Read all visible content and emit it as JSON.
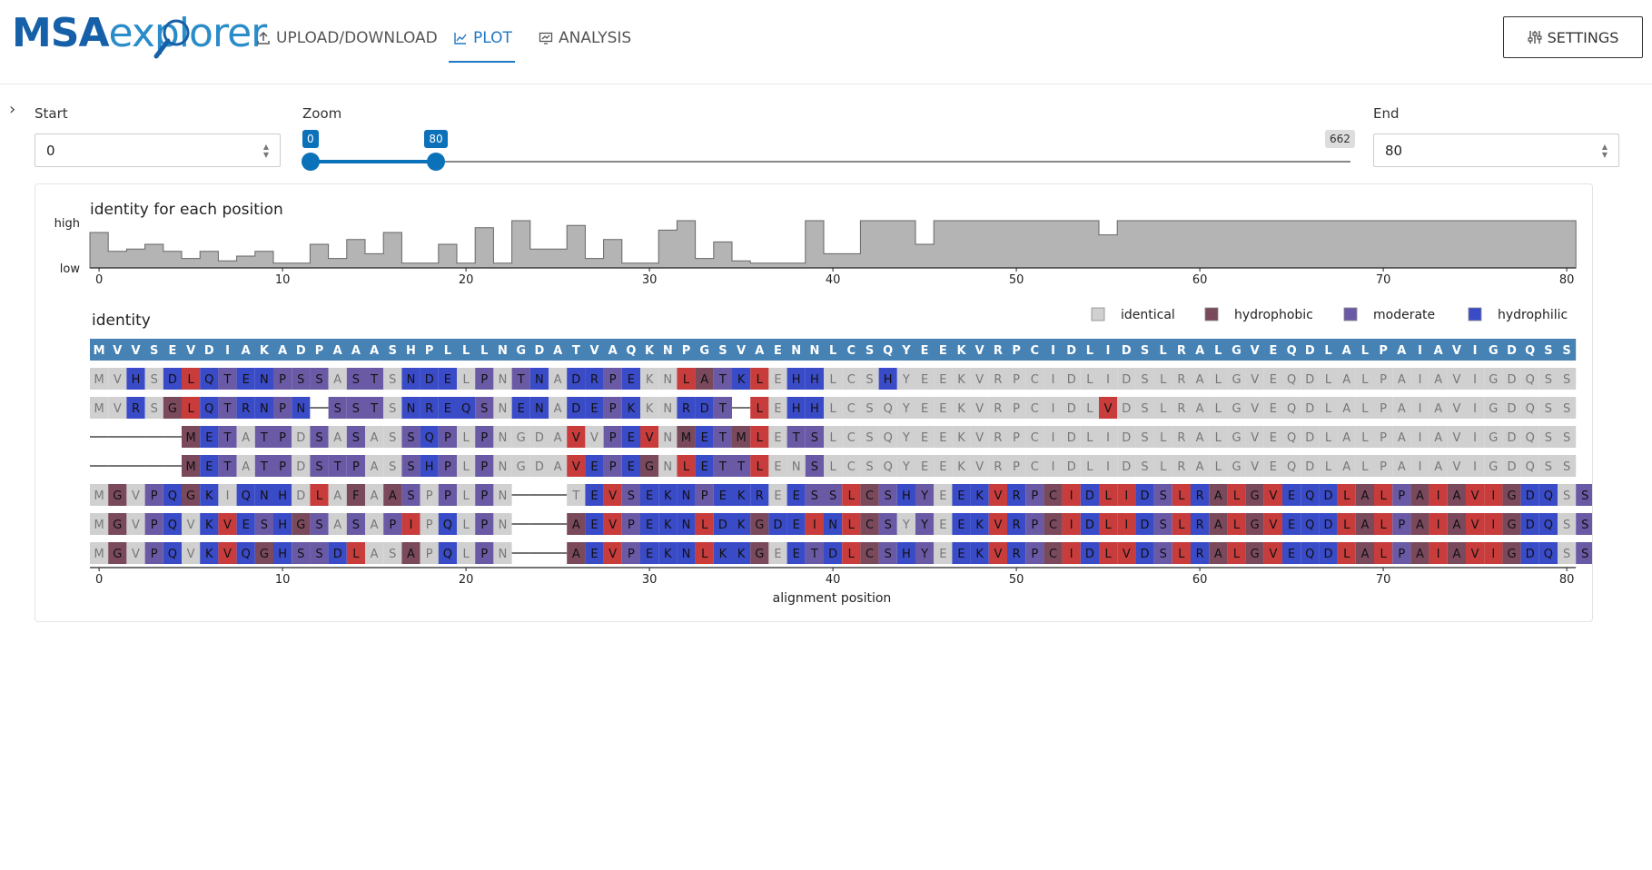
{
  "app": {
    "logo_main": "MSA",
    "logo_rest": "explorer"
  },
  "nav": [
    {
      "label": "UPLOAD/DOWNLOAD",
      "icon": "upload-icon",
      "active": false
    },
    {
      "label": "PLOT",
      "icon": "chart-icon",
      "active": true
    },
    {
      "label": "ANALYSIS",
      "icon": "analysis-icon",
      "active": false
    }
  ],
  "settings_label": "SETTINGS",
  "controls": {
    "start_label": "Start",
    "start_value": "0",
    "zoom_label": "Zoom",
    "zoom_start": "0",
    "zoom_end": "80",
    "zoom_max": "662",
    "zoom_range": [
      0,
      80
    ],
    "zoom_domain": [
      0,
      662
    ],
    "end_label": "End",
    "end_value": "80"
  },
  "identity_plot": {
    "title": "identity for each position",
    "y_high": "high",
    "y_low": "low",
    "ticks": [
      "0",
      "10",
      "20",
      "30",
      "40",
      "50",
      "60",
      "70",
      "80"
    ]
  },
  "alignment_plot": {
    "title": "identity",
    "xlabel": "alignment position",
    "ticks": [
      "0",
      "10",
      "20",
      "30",
      "40",
      "50",
      "60",
      "70",
      "80"
    ],
    "legend": [
      {
        "label": "identical",
        "color": "#d0d0d0"
      },
      {
        "label": "hydrophobic",
        "color": "#7a4a5c"
      },
      {
        "label": "moderate",
        "color": "#6a5aa6"
      },
      {
        "label": "hydrophilic",
        "color": "#3a4bc8"
      }
    ],
    "consensus": "MVVSEVDIAKADPAAASHPLLLNGDATVAQKNPGSVAENNLCSQYEEKVRPCIDLIDSLRALGVEQDLALPAIAVIGDQSS",
    "sequences": [
      "MVHSDLQTENPSSASTSNDELPNTNADRPEKNLATKLEHHLCSHYEEKVRPCIDLIDSLRALGVEQDLALPAIAVIGDQSS",
      "MVRSGLQTRNPN-SSTSNREQSNENADEPKKNRDT-LEHHLCSQYEEKVRPCIDLVDSLRALGVEQDLALPAIAVIGDQSS",
      "-----METATPDSASASSQPLPNGDAVVPEVNMETMLETSLCSQYEEKVRPCIDLIDSLRALGVEQDLALPAIAVIGDQSS",
      "-----METATPDSTPASSHPLPNGDAVEPEGNLETTLENSLCSQYEEKVRPCIDLIDSLRALGVEQDLALPAIAVIGDQSS",
      "MGVPQGKIQNHDLAFAASPPLPN---TEVSEKNPEKREESSLCSHYEEKVRPCIDLIDSLRALGVEQDLALPAIAVIGDQSS",
      "MGVPQVKVESHGSASAPIPQLPN---AEVPEKNLDKGDEINLCSYYEEKVRPCIDLIDSLRALGVEQDLALPAIAVIGDQSS",
      "MGVPQVKVQGHSSDLASAPQLPN---AEVPEKNLKKGEETDLCSHYEEKVRPCIDLVDSLRALGVEQDLALPAIAVIGDQSS"
    ],
    "colors": {
      "consensus_bg": "#4682b4",
      "identical": "#d0d0d0",
      "hydrophobic": "#7a4a5c",
      "moderate": "#6a5aa6",
      "hydrophilic": "#3a4bc8",
      "mismatch": "#c83c3c"
    }
  },
  "chart_data": {
    "type": "area",
    "title": "identity for each position",
    "y_labels": [
      "low",
      "high"
    ],
    "x": [
      0,
      1,
      2,
      3,
      4,
      5,
      6,
      7,
      8,
      9,
      10,
      11,
      12,
      13,
      14,
      15,
      16,
      17,
      18,
      19,
      20,
      21,
      22,
      23,
      24,
      25,
      26,
      27,
      28,
      29,
      30,
      31,
      32,
      33,
      34,
      35,
      36,
      37,
      38,
      39,
      40,
      41,
      42,
      43,
      44,
      45,
      46,
      47,
      48,
      49,
      50,
      51,
      52,
      53,
      54,
      55,
      56,
      57,
      58,
      59,
      60,
      61,
      62,
      63,
      64,
      65,
      66,
      67,
      68,
      69,
      70,
      71,
      72,
      73,
      74,
      75,
      76,
      77,
      78,
      79,
      80
    ],
    "values": [
      0.75,
      0.35,
      0.4,
      0.5,
      0.35,
      0.2,
      0.35,
      0.15,
      0.25,
      0.35,
      0.1,
      0.1,
      0.5,
      0.2,
      0.6,
      0.3,
      0.75,
      0.1,
      0.1,
      0.5,
      0.1,
      0.85,
      0.1,
      1.0,
      0.4,
      0.4,
      0.9,
      0.2,
      0.6,
      0.1,
      0.1,
      0.8,
      1.0,
      0.2,
      0.55,
      0.15,
      0.1,
      0.1,
      0.1,
      1.0,
      0.3,
      0.3,
      1.0,
      1.0,
      1.0,
      0.5,
      1.0,
      1.0,
      1.0,
      1.0,
      1.0,
      1.0,
      1.0,
      1.0,
      1.0,
      0.7,
      1.0,
      1.0,
      1.0,
      1.0,
      1.0,
      1.0,
      1.0,
      1.0,
      1.0,
      1.0,
      1.0,
      1.0,
      1.0,
      1.0,
      1.0,
      1.0,
      1.0,
      1.0,
      1.0,
      1.0,
      1.0,
      1.0,
      1.0,
      1.0,
      1.0
    ],
    "xlim": [
      0,
      80
    ],
    "xlabel": ""
  }
}
